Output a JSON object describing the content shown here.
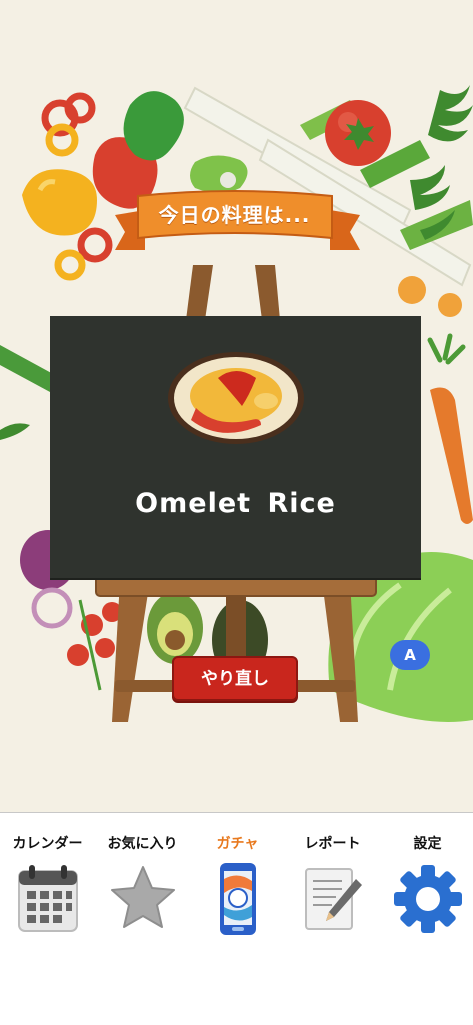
{
  "banner": {
    "title": "今日の料理は..."
  },
  "result": {
    "dish_name": "Omelet  Rice",
    "dish_icon": "omelet-rice-icon"
  },
  "actions": {
    "redo_label": "やり直し",
    "floating_label": "A"
  },
  "tabs": [
    {
      "label": "カレンダー",
      "icon": "calendar-icon",
      "active": false
    },
    {
      "label": "お気に入り",
      "icon": "star-icon",
      "active": false
    },
    {
      "label": "ガチャ",
      "icon": "gacha-phone-icon",
      "active": true
    },
    {
      "label": "レポート",
      "icon": "report-pencil-icon",
      "active": false
    },
    {
      "label": "設定",
      "icon": "gear-icon",
      "active": false
    }
  ],
  "colors": {
    "accent": "#e8791e",
    "board": "#2f332e",
    "redo_button": "#c9261d",
    "background": "#f4f0e4",
    "fab": "#3a6fe0"
  }
}
